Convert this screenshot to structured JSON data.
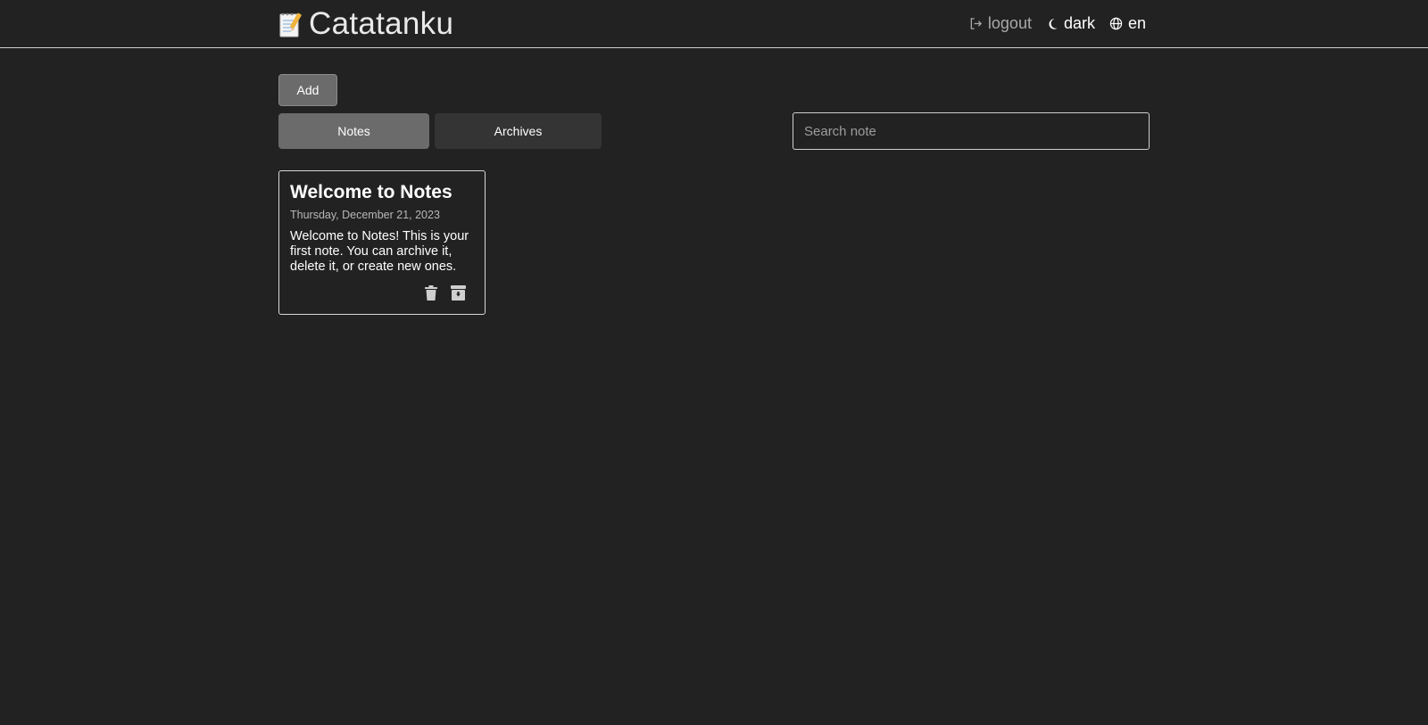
{
  "header": {
    "brand_icon": "memo-icon",
    "title": "Catatanku",
    "logout_label": "logout",
    "theme_label": "dark",
    "language_label": "en"
  },
  "toolbar": {
    "add_label": "Add"
  },
  "tabs": [
    {
      "label": "Notes",
      "active": true
    },
    {
      "label": "Archives",
      "active": false
    }
  ],
  "search": {
    "placeholder": "Search note",
    "value": ""
  },
  "notes": [
    {
      "title": "Welcome to Notes",
      "date": "Thursday, December 21, 2023",
      "body": "Welcome to Notes! This is your first note. You can archive it, delete it, or create new ones.",
      "actions": [
        "trash-icon",
        "archive-icon"
      ]
    }
  ],
  "colors": {
    "background": "#222222",
    "active_tab": "#6b6b6b",
    "inactive_tab": "#343434",
    "border": "#cfcfcf"
  }
}
